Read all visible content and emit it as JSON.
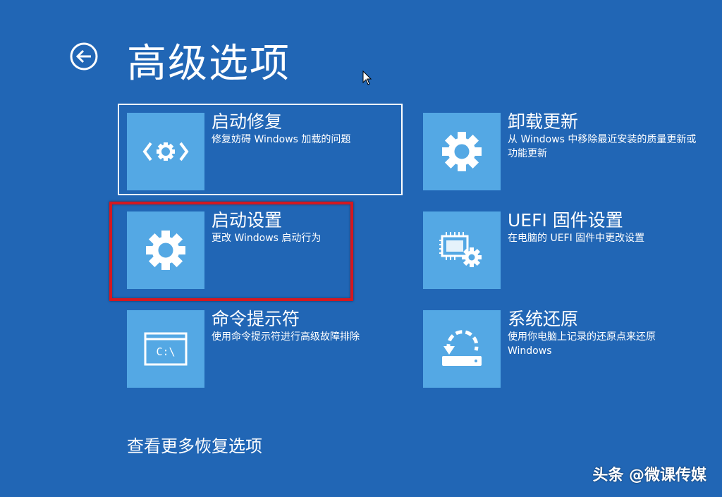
{
  "header": {
    "title": "高级选项",
    "back_icon": "back-arrow-icon"
  },
  "options": [
    {
      "id": "startup-repair",
      "title": "启动修复",
      "desc": "修复妨碍 Windows 加载的问题",
      "icon": "code-gear-icon",
      "selected": true
    },
    {
      "id": "uninstall-updates",
      "title": "卸载更新",
      "desc": "从 Windows 中移除最近安装的质量更新或功能更新",
      "icon": "gear-icon"
    },
    {
      "id": "startup-settings",
      "title": "启动设置",
      "desc": "更改 Windows 启动行为",
      "icon": "gear-icon",
      "highlighted": true
    },
    {
      "id": "uefi-settings",
      "title": "UEFI 固件设置",
      "desc": "在电脑的 UEFI 固件中更改设置",
      "icon": "chip-gear-icon"
    },
    {
      "id": "command-prompt",
      "title": "命令提示符",
      "desc": "使用命令提示符进行高级故障排除",
      "icon": "terminal-icon",
      "icon_text": "C:\\"
    },
    {
      "id": "system-restore",
      "title": "系统还原",
      "desc": "使用你电脑上记录的还原点来还原 Windows",
      "icon": "restore-icon"
    }
  ],
  "footer": {
    "more_options": "查看更多恢复选项"
  },
  "watermark": "头条 @微课传媒",
  "colors": {
    "background": "#2166b5",
    "tile": "#54a8e4",
    "highlight_box": "#d41820"
  }
}
